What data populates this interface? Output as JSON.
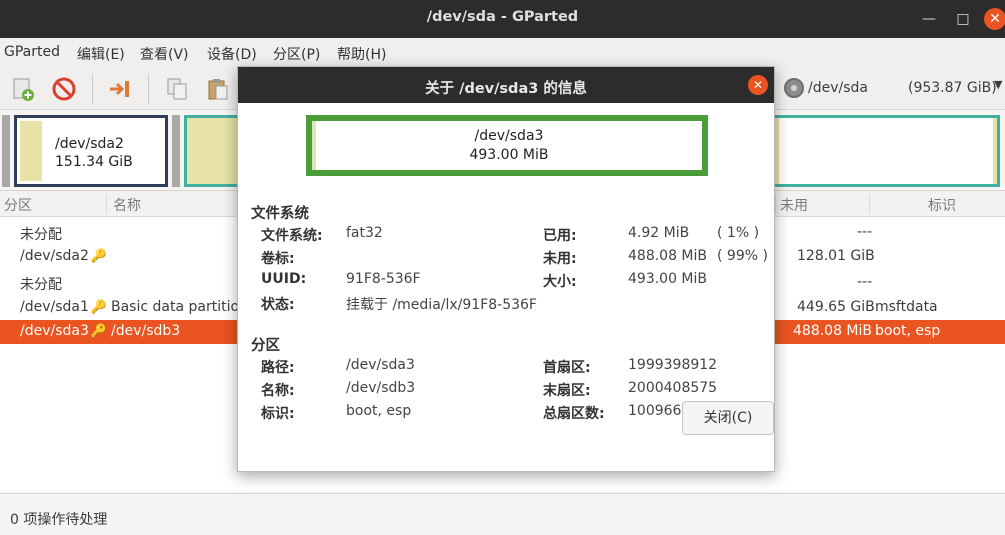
{
  "window": {
    "title": "/dev/sda - GParted"
  },
  "menubar": {
    "items": [
      "GParted",
      "编辑(E)",
      "查看(V)",
      "设备(D)",
      "分区(P)",
      "帮助(H)"
    ]
  },
  "toolbar": {
    "icons": [
      "new-partition-icon",
      "delete-icon",
      "resize-move-icon",
      "copy-icon",
      "paste-icon"
    ],
    "device": {
      "name": "/dev/sda",
      "size": "(953.87 GiB)"
    }
  },
  "diskmap": {
    "selected_name": "/dev/sda2",
    "selected_size": "151.34 GiB"
  },
  "partitions": {
    "columns": [
      "分区",
      "名称",
      "未用",
      "标识"
    ],
    "rows": [
      {
        "partition": "未分配",
        "name": "",
        "unused": "---",
        "flags": "",
        "key": false
      },
      {
        "partition": "/dev/sda2",
        "name": "",
        "unused": "128.01 GiB",
        "flags": "",
        "key": true
      },
      {
        "partition": "未分配",
        "name": "",
        "unused": "---",
        "flags": "",
        "key": false
      },
      {
        "partition": "/dev/sda1",
        "name": "Basic data partition",
        "unused": "449.65 GiB",
        "flags": "msftdata",
        "key": true
      },
      {
        "partition": "/dev/sda3",
        "name": "/dev/sdb3",
        "unused": "488.08 MiB",
        "flags": "boot, esp",
        "key": true,
        "selected": true
      }
    ]
  },
  "statusbar": {
    "text": "0 项操作待处理"
  },
  "dialog": {
    "title": "关于 /dev/sda3 的信息",
    "partition_name": "/dev/sda3",
    "partition_size": "493.00 MiB",
    "filesystem": {
      "heading": "文件系统",
      "fs_label": "文件系统:",
      "fs_value": "fat32",
      "label_label": "卷标:",
      "label_value": "",
      "uuid_label": "UUID:",
      "uuid_value": "91F8-536F",
      "status_label": "状态:",
      "status_value": "挂载于 /media/lx/91F8-536F",
      "used_label": "已用:",
      "used_value": "4.92 MiB",
      "used_pct": "( 1% )",
      "unused_label": "未用:",
      "unused_value": "488.08 MiB",
      "unused_pct": "( 99% )",
      "size_label": "大小:",
      "size_value": "493.00 MiB"
    },
    "partition": {
      "heading": "分区",
      "path_label": "路径:",
      "path_value": "/dev/sda3",
      "name_label": "名称:",
      "name_value": "/dev/sdb3",
      "flags_label": "标识:",
      "flags_value": "boot, esp",
      "first_label": "首扇区:",
      "first_value": "1999398912",
      "last_label": "末扇区:",
      "last_value": "2000408575",
      "total_label": "总扇区数:",
      "total_value": "1009664"
    },
    "close_label": "关闭(C)"
  },
  "colors": {
    "accent": "#e95420",
    "titlebar": "#2c2c2c",
    "fat32": "#4a9e3a",
    "ntfs": "#42b0a0"
  }
}
